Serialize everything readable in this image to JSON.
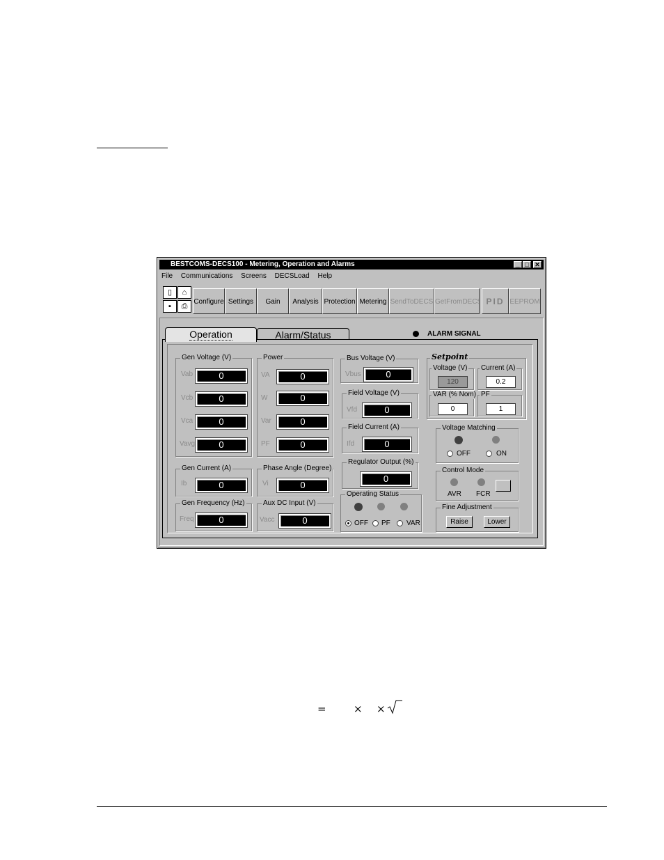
{
  "page": {
    "formula": {
      "equals": "=",
      "times1": "×",
      "times2": "×"
    }
  },
  "window": {
    "title": "BESTCOMS-DECS100 - Metering, Operation and Alarms",
    "menu": [
      "File",
      "Communications",
      "Screens",
      "DECSLoad",
      "Help"
    ],
    "toolbar": [
      "Configure",
      "Settings",
      "Gain",
      "Analysis",
      "Protection",
      "Metering",
      "SendToDECS",
      "GetFromDECS",
      "PID",
      "EEPROM"
    ],
    "tabs": [
      "Operation",
      "Alarm/Status"
    ],
    "alarm_signal": "ALARM SIGNAL"
  },
  "gen_voltage": {
    "title": "Gen Voltage (V)",
    "rows": [
      {
        "label": "Vab",
        "value": "0"
      },
      {
        "label": "Vcb",
        "value": "0"
      },
      {
        "label": "Vca",
        "value": "0"
      },
      {
        "label": "Vavg",
        "value": "0"
      }
    ]
  },
  "power": {
    "title": "Power",
    "rows": [
      {
        "label": "VA",
        "value": "0"
      },
      {
        "label": "W",
        "value": "0"
      },
      {
        "label": "Var",
        "value": "0"
      },
      {
        "label": "PF",
        "value": "0"
      }
    ]
  },
  "gen_current": {
    "title": "Gen Current (A)",
    "label": "Ib",
    "value": "0"
  },
  "phase_angle": {
    "title": "Phase Angle (Degree)",
    "label": "Vi",
    "value": "0"
  },
  "gen_frequency": {
    "title": "Gen Frequency (Hz)",
    "label": "Freq",
    "value": "0"
  },
  "aux_dc": {
    "title": "Aux DC Input (V)",
    "label": "Vacc",
    "value": "0"
  },
  "bus_voltage": {
    "title": "Bus Voltage (V)",
    "label": "Vbus",
    "value": "0"
  },
  "field_voltage": {
    "title": "Field Voltage (V)",
    "label": "Vfd",
    "value": "0"
  },
  "field_current": {
    "title": "Field Current (A)",
    "label": "Ifd",
    "value": "0"
  },
  "regulator_output": {
    "title": "Regulator Output (%)",
    "value": "0"
  },
  "operating_status": {
    "title": "Operating Status",
    "options": [
      "OFF",
      "PF",
      "VAR"
    ]
  },
  "setpoint": {
    "title": "Setpoint",
    "voltage": {
      "title": "Voltage (V)",
      "value": "120"
    },
    "current": {
      "title": "Current (A)",
      "value": "0.2"
    },
    "var": {
      "title": "VAR (% Nom)",
      "value": "0"
    },
    "pf": {
      "title": "PF",
      "value": "1"
    }
  },
  "voltage_matching": {
    "title": "Voltage Matching",
    "options": [
      "OFF",
      "ON"
    ]
  },
  "control_mode": {
    "title": "Control Mode",
    "options": [
      "AVR",
      "FCR"
    ]
  },
  "fine_adjustment": {
    "title": "Fine Adjustment",
    "raise": "Raise",
    "lower": "Lower"
  }
}
